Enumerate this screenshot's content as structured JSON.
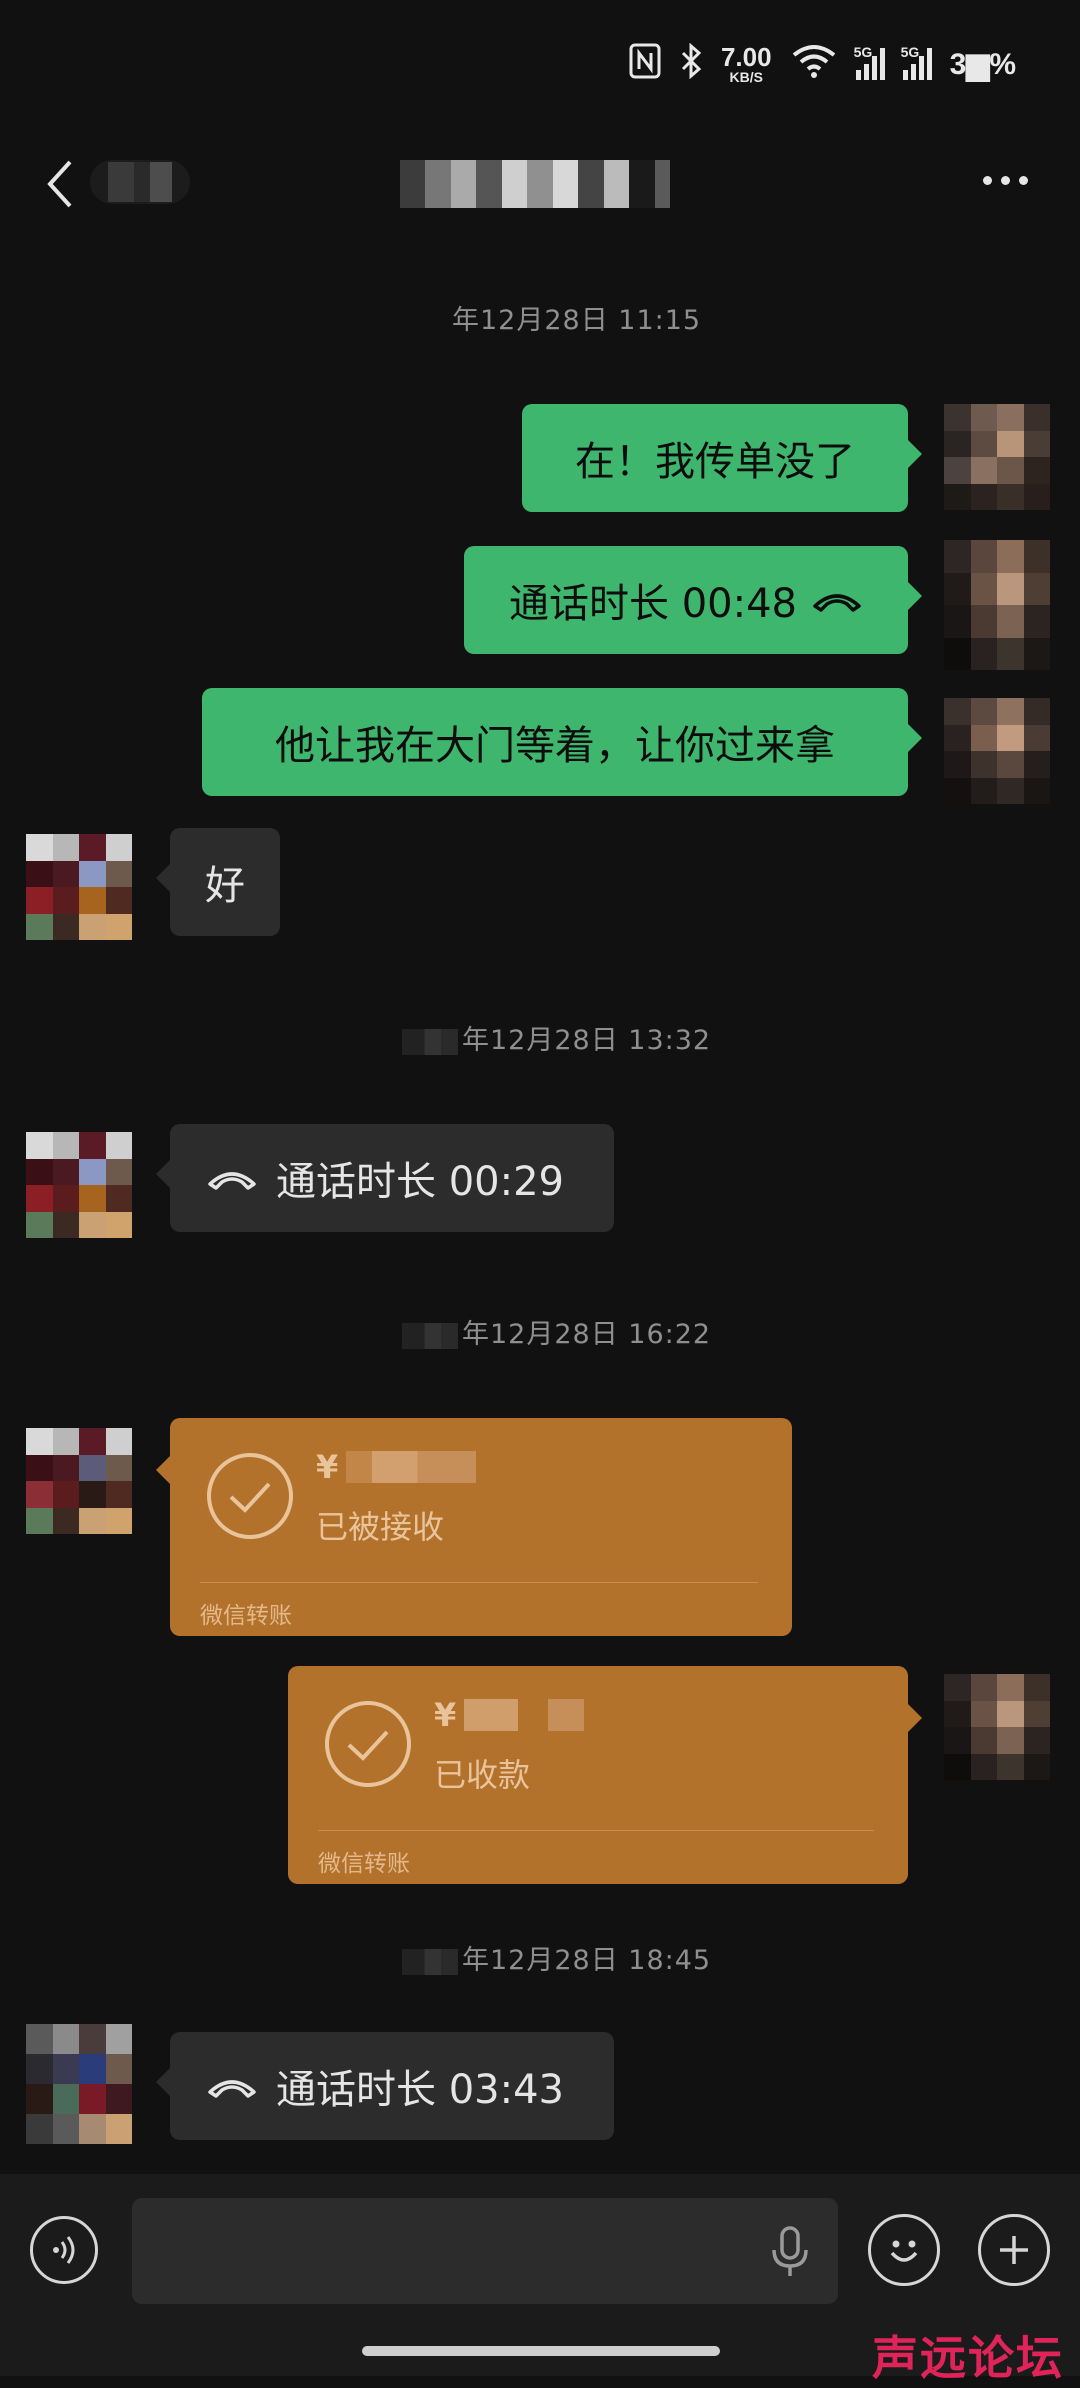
{
  "status_bar": {
    "net_speed_value": "7.00",
    "net_speed_unit": "KB/S",
    "signal1_label": "5G",
    "signal2_label": "5G",
    "battery_text": "3▆%"
  },
  "header": {
    "back_icon": "chevron-left-icon",
    "more_icon": "more-dots-icon"
  },
  "messages": {
    "ts1": "年12月28日 11:15",
    "m1": "在！我传单没了",
    "m2": "通话时长 00:48",
    "m3": "他让我在大门等着，让你过来拿",
    "m4": "好",
    "ts2": "年12月28日 13:32",
    "m5": "通话时长 00:29",
    "ts3": "年12月28日 16:22",
    "t1_currency": "¥",
    "t1_status": "已被接收",
    "t1_label": "微信转账",
    "t2_currency": "¥",
    "t2_status": "已收款",
    "t2_label": "微信转账",
    "ts4": "年12月28日 18:45",
    "m6": "通话时长 03:43"
  },
  "input_bar": {
    "voice_icon": "voice-mode-icon",
    "mic_icon": "microphone-icon",
    "emoji_icon": "emoji-icon",
    "plus_icon": "plus-icon"
  },
  "watermark": "声远论坛",
  "colors": {
    "background": "#111111",
    "green_bubble": "#3fb66d",
    "gray_bubble": "#2c2c2c",
    "transfer_card": "#b3722c",
    "watermark": "#e0245a"
  }
}
